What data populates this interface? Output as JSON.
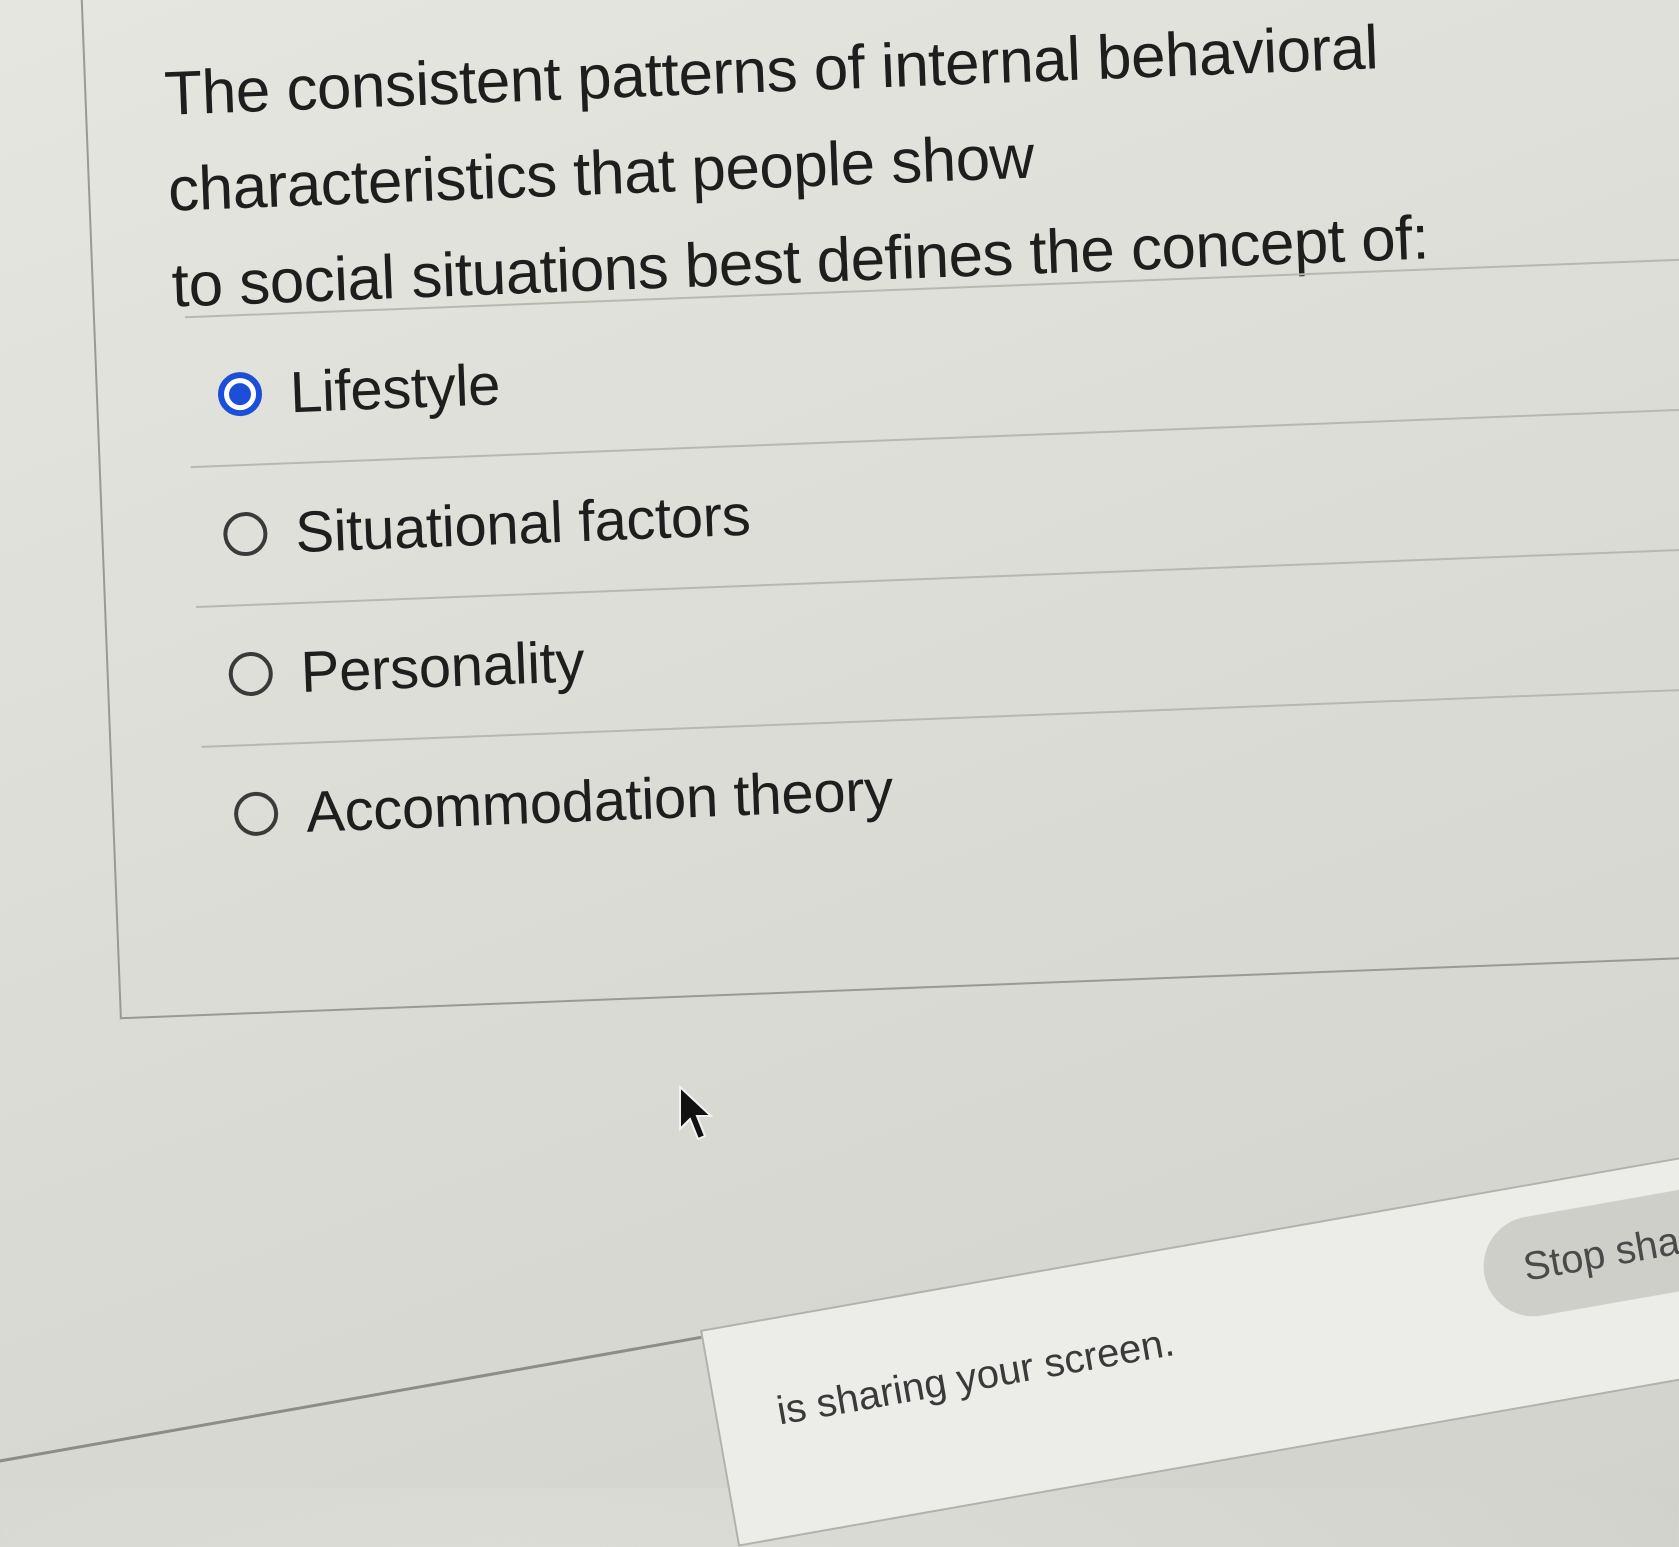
{
  "question": {
    "text_line1": "The consistent patterns of internal behavioral characteristics that people show",
    "text_line2": "to social situations best defines the concept of:"
  },
  "options": [
    {
      "label": "Lifestyle",
      "selected": true
    },
    {
      "label": "Situational factors",
      "selected": false
    },
    {
      "label": "Personality",
      "selected": false
    },
    {
      "label": "Accommodation theory",
      "selected": false
    }
  ],
  "share_bar": {
    "message": "is sharing your screen.",
    "stop_label": "Stop shar"
  },
  "colors": {
    "accent": "#1d4ed8",
    "background": "#dcdcd6",
    "text": "#1e1e1e"
  }
}
